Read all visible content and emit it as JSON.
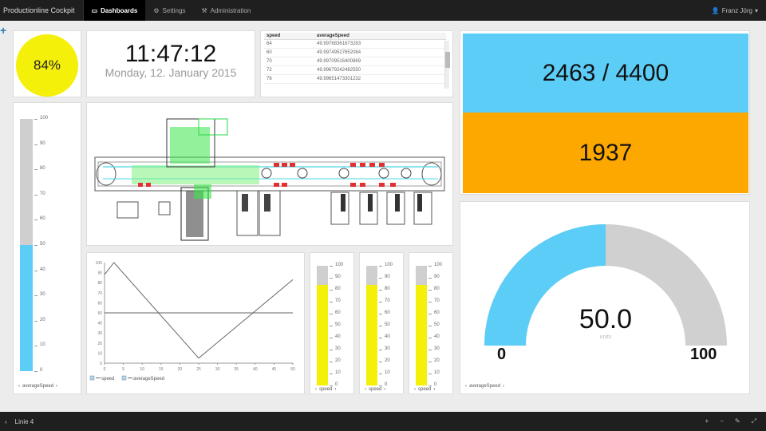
{
  "topbar": {
    "brand": "Productionline Cockpit",
    "tabs": [
      {
        "label": "Dashboards",
        "icon": "monitor-icon",
        "active": true
      },
      {
        "label": "Settings",
        "icon": "gear-icon",
        "active": false
      },
      {
        "label": "Administration",
        "icon": "wrench-icon",
        "active": false
      }
    ],
    "user": "Franz Jörg"
  },
  "add_widget": "+",
  "percent_widget": {
    "value": "84%",
    "color": "#f5f00a"
  },
  "clock": {
    "time": "11:47:12",
    "date": "Monday, 12. January 2015"
  },
  "speed_table": {
    "headers": [
      "speed",
      "averageSpeed"
    ],
    "rows": [
      [
        "64",
        "49.99768361673283"
      ],
      [
        "60",
        "49.99749527652084"
      ],
      [
        "70",
        "49.99709516400869"
      ],
      [
        "72",
        "49.99679242482550"
      ],
      [
        "76",
        "49.99651473301232"
      ]
    ]
  },
  "counter": {
    "top": "2463 / 4400",
    "bottom": "1937",
    "top_color": "#5ccdf6",
    "bottom_color": "#fca800"
  },
  "vertical_gauge_large": {
    "ticks": [
      "100",
      "90",
      "80",
      "70",
      "60",
      "50",
      "40",
      "30",
      "20",
      "10",
      "0"
    ],
    "value": 50,
    "fill_color": "#5ccdf6",
    "caption": "averageSpeed"
  },
  "line_chart": {
    "y_ticks": [
      "100",
      "90",
      "80",
      "70",
      "60",
      "50",
      "40",
      "30",
      "20",
      "10",
      "0"
    ],
    "x_ticks": [
      "0",
      "5",
      "10",
      "15",
      "20",
      "25",
      "30",
      "35",
      "40",
      "45",
      "50"
    ],
    "legend": [
      "speed",
      "averageSpeed"
    ]
  },
  "chart_data": {
    "type": "line",
    "x": [
      0,
      2.5,
      25,
      50
    ],
    "series": [
      {
        "name": "speed",
        "points": [
          [
            0,
            88
          ],
          [
            2.5,
            100
          ],
          [
            25,
            5
          ],
          [
            50,
            83
          ]
        ]
      },
      {
        "name": "averageSpeed",
        "points": [
          [
            0,
            50
          ],
          [
            50,
            50
          ]
        ]
      }
    ],
    "xlim": [
      0,
      50
    ],
    "ylim": [
      0,
      100
    ],
    "legend_position": "bottom-left"
  },
  "small_gauges": [
    {
      "value": 84,
      "caption": "speed"
    },
    {
      "value": 84,
      "caption": "speed"
    },
    {
      "value": 84,
      "caption": "speed"
    }
  ],
  "small_gauge_ticks": [
    "100",
    "90",
    "80",
    "70",
    "60",
    "50",
    "40",
    "30",
    "20",
    "10",
    "0"
  ],
  "semi_gauge": {
    "value": "50.0",
    "units": "units",
    "min": "0",
    "max": "100",
    "fraction": 0.5,
    "fill_color": "#5ccdf6",
    "caption": "averageSpeed"
  },
  "bottombar": {
    "title": "Linie 4",
    "icons": [
      "plus-icon",
      "minus-icon",
      "edit-icon",
      "expand-icon"
    ]
  }
}
